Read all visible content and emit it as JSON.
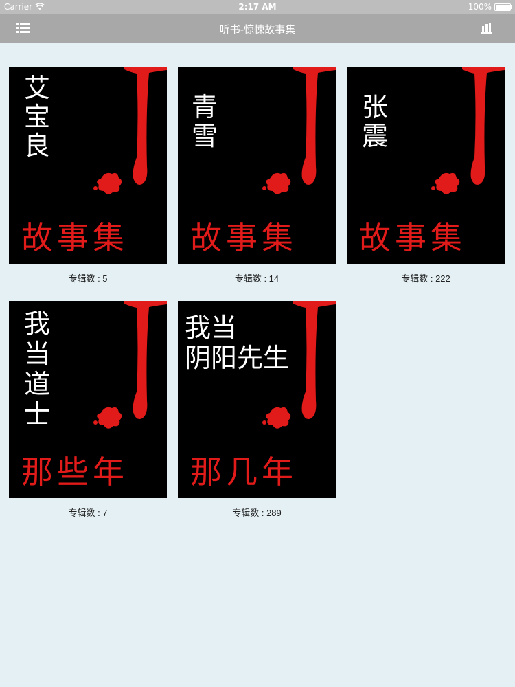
{
  "status_bar": {
    "carrier": "Carrier",
    "time": "2:17 AM",
    "battery": "100%",
    "battery_level": 1.0
  },
  "nav_bar": {
    "title": "听书-惊悚故事集",
    "left_icon": "menu-list-icon",
    "right_icon": "bar-chart-icon"
  },
  "albums": [
    {
      "title_lines": [
        "艾",
        "宝",
        "良"
      ],
      "subtitle": "故事集",
      "count_label": "专辑数 : 5"
    },
    {
      "title_lines": [
        "青",
        "雪"
      ],
      "subtitle": "故事集",
      "count_label": "专辑数 : 14"
    },
    {
      "title_lines": [
        "张",
        "震"
      ],
      "subtitle": "故事集",
      "count_label": "专辑数 : 222"
    },
    {
      "title_lines": [
        "我",
        "当",
        "道",
        "士"
      ],
      "subtitle": "那些年",
      "count_label": "专辑数 : 7"
    },
    {
      "title_lines": [
        "我当",
        "阴阳先生"
      ],
      "subtitle": "那几年",
      "count_label": "专辑数 : 289"
    }
  ],
  "colors": {
    "blood_red": "#e11a1a",
    "nav_bg": "#a8a8a8",
    "page_bg": "#e4f0f4"
  }
}
